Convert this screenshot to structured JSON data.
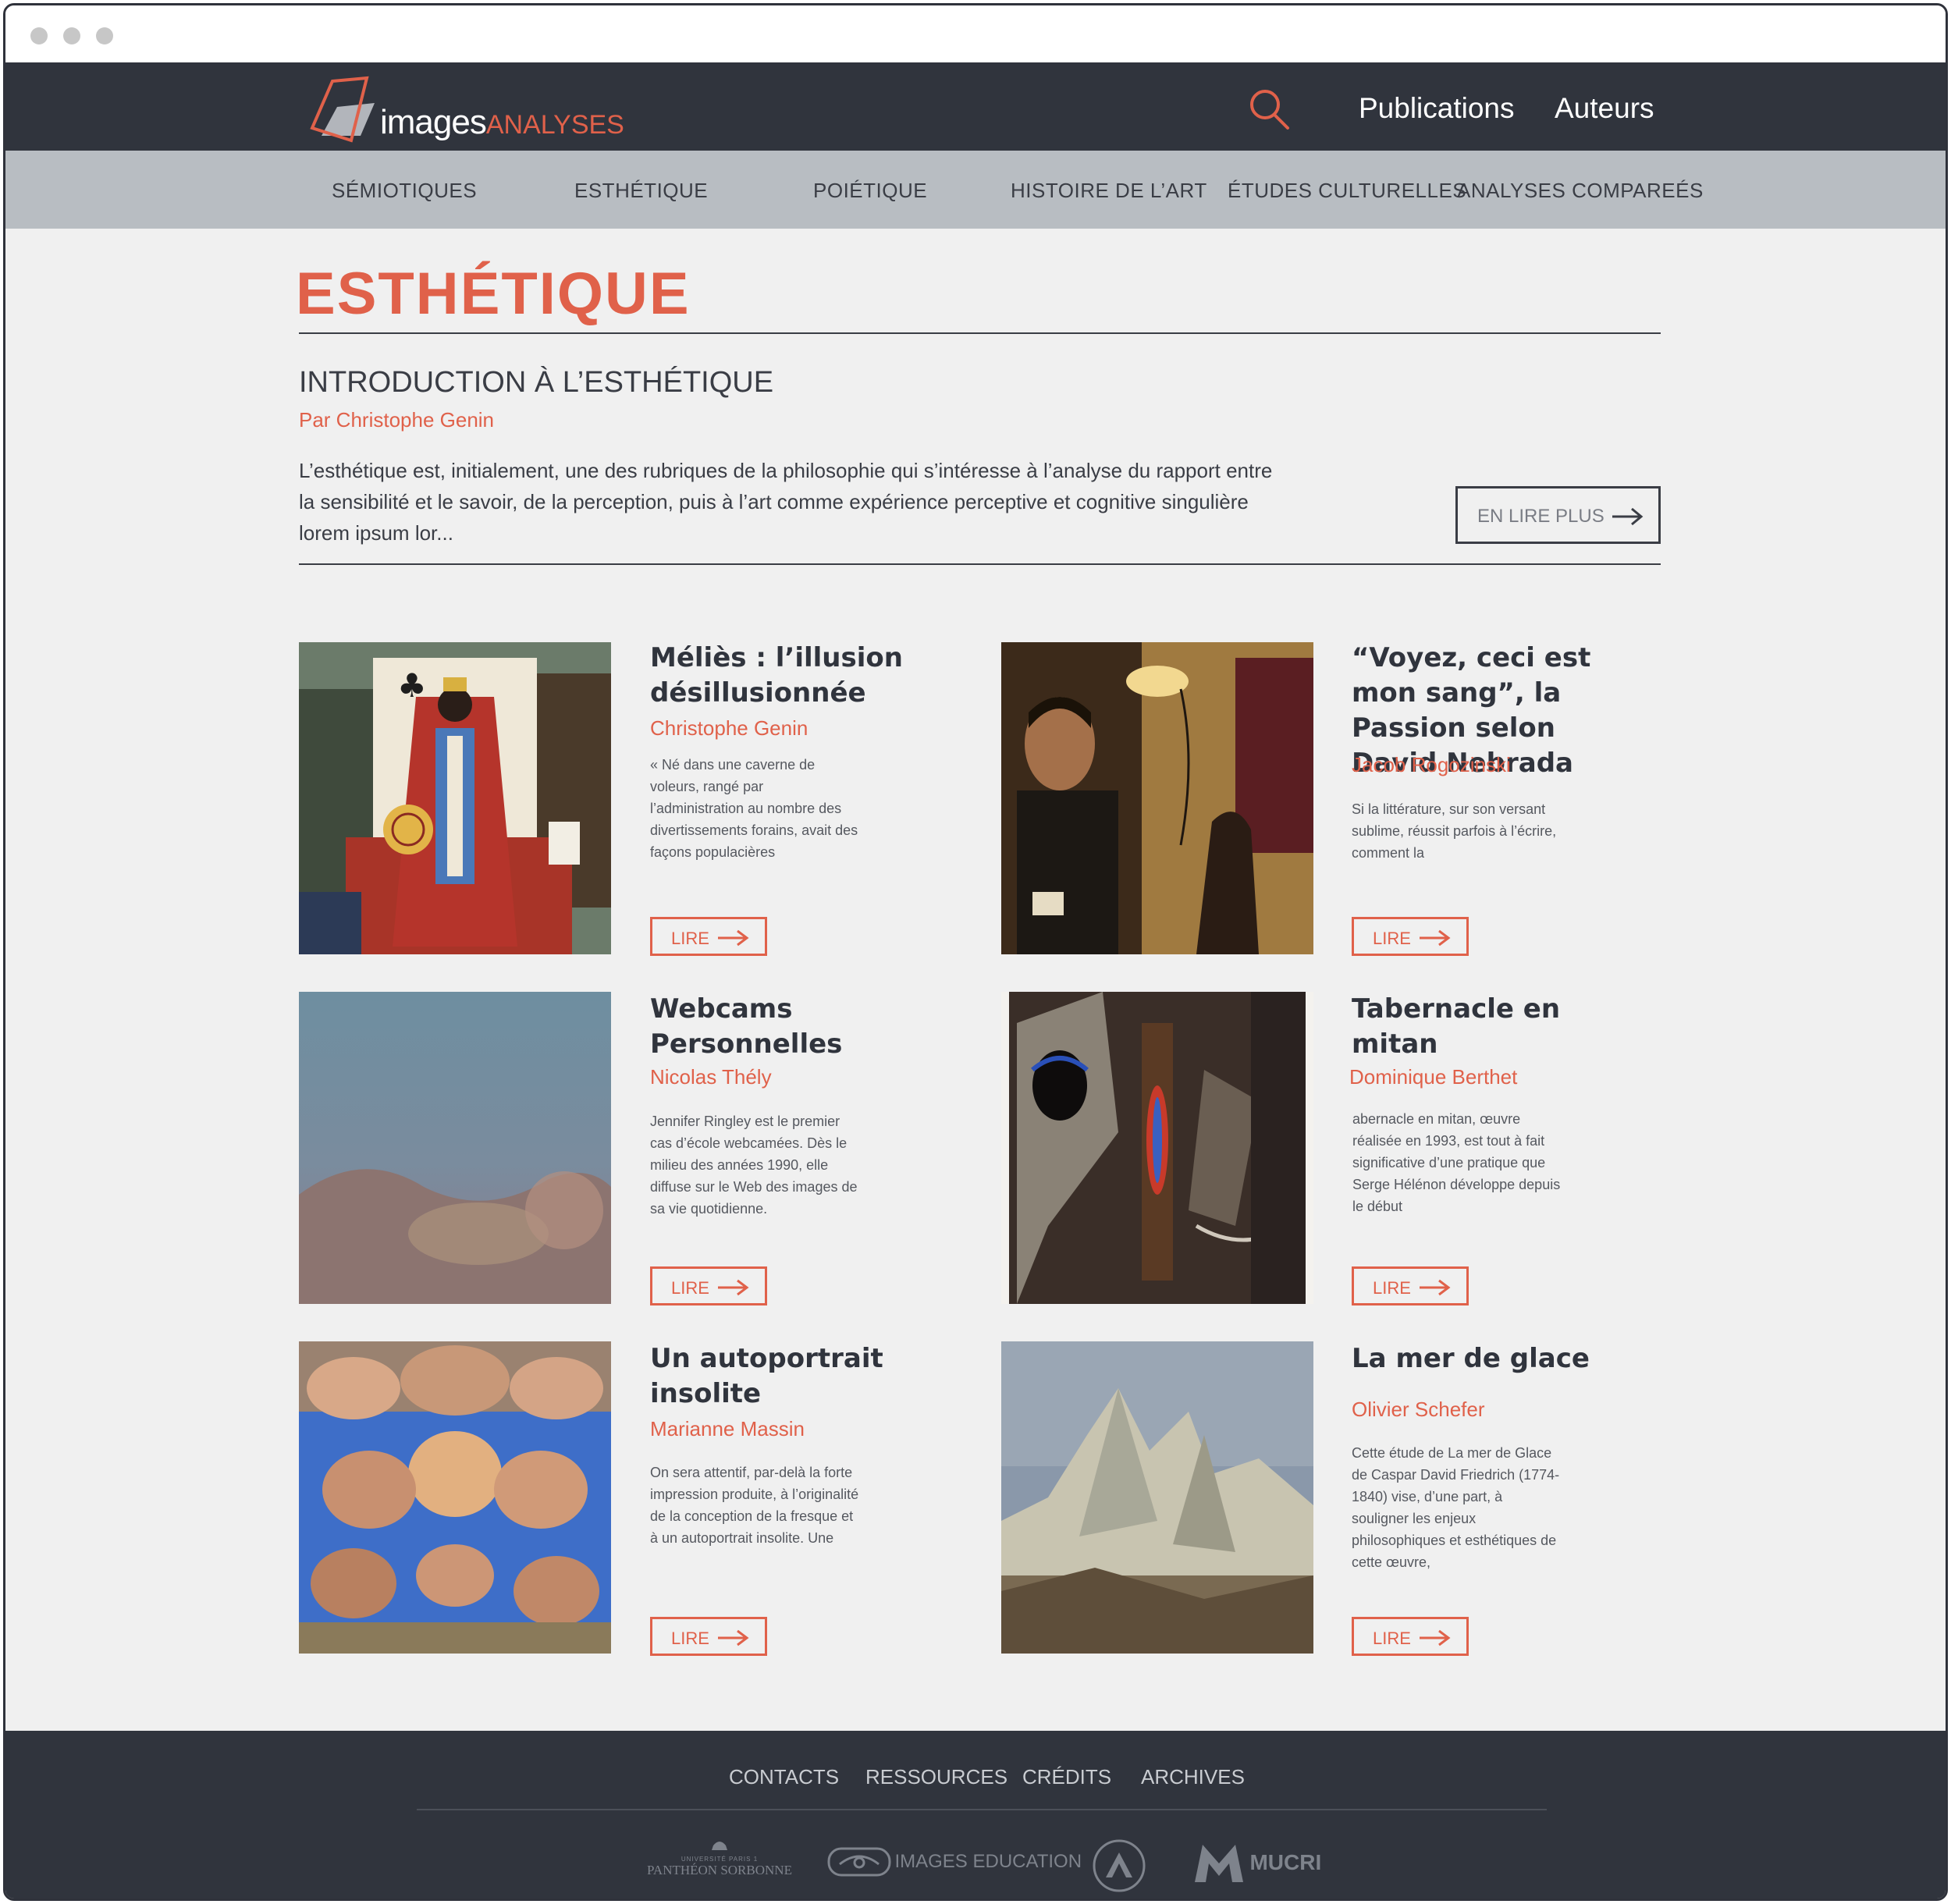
{
  "header": {
    "logo_main": "images",
    "logo_accent": "ANALYSES",
    "nav": [
      "Publications",
      "Auteurs"
    ]
  },
  "categories": [
    "SÉMIOTIQUES",
    "ESTHÉTIQUE",
    "POIÉTIQUE",
    "HISTOIRE DE L’ART",
    "ÉTUDES CULTURELLES",
    "ANALYSES COMPAREÉS"
  ],
  "page": {
    "title": "ESTHÉTIQUE",
    "intro": {
      "title": "INTRODUCTION À L’ESTHÉTIQUE",
      "author": "Par Christophe Genin",
      "text": "L’esthétique est, initialement, une des rubriques de la philosophie qui s’intéresse à l’analyse du rapport entre la sensibilité et le savoir, de la perception, puis à l’art comme expérience perceptive et cognitive singulière lorem ipsum lor...",
      "read_more": "EN LIRE PLUS"
    }
  },
  "articles": [
    {
      "title": "Méliès : l’illusion désillusionnée",
      "author": "Christophe Genin",
      "excerpt": "« Né dans une caverne de voleurs, rangé par l’administration au nombre des divertissements forains, avait des façons populacières",
      "button": "LIRE"
    },
    {
      "title": "“Voyez, ceci est mon sang”, la Passion selon David Nebrada",
      "author": "Jacob Rogozinski",
      "excerpt": "Si la littérature, sur son versant sublime, réussit parfois à l’écrire, comment la",
      "button": "LIRE"
    },
    {
      "title": "Webcams Personnelles",
      "author": "Nicolas Thély",
      "excerpt": "Jennifer Ringley est le premier cas d’école webcamées. Dès le milieu des années 1990, elle diffuse sur le Web des images de sa vie quotidienne.",
      "button": "LIRE"
    },
    {
      "title": "Tabernacle en mitan",
      "author": "Dominique Berthet",
      "excerpt": "abernacle en mitan, œuvre réalisée en 1993, est tout à fait significative d’une pratique que Serge Hélénon développe depuis le début",
      "button": "LIRE"
    },
    {
      "title": "Un autoportrait insolite",
      "author": "Marianne Massin",
      "excerpt": "On sera attentif, par-delà la forte impression produite, à l’originalité de la conception de la fresque et à un autoportrait insolite. Une",
      "button": "LIRE"
    },
    {
      "title": "La mer de glace",
      "author": "Olivier Schefer",
      "excerpt": "Cette étude de La mer de Glace de Caspar David Friedrich (1774-1840) vise, d’une part, à souligner les enjeux philosophiques et esthétiques de cette œuvre,",
      "button": "LIRE"
    }
  ],
  "footer": {
    "links": [
      "CONTACTS",
      "RESSOURCES",
      "CRÉDITS",
      "ARCHIVES"
    ],
    "partners": {
      "pantheon_small": "UNIVERSITÉ PARIS 1",
      "pantheon": "PANTHÉON SORBONNE",
      "images_education": "IMAGES EDUCATION",
      "mucri": "MUCRI"
    }
  },
  "colors": {
    "accent": "#e0614a",
    "dark": "#30343d",
    "subnav": "#b8bdc2",
    "background": "#f0f0f0"
  },
  "icons": [
    "search-icon",
    "arrow-right-icon",
    "eye-icon",
    "triangle-logo-icon"
  ]
}
